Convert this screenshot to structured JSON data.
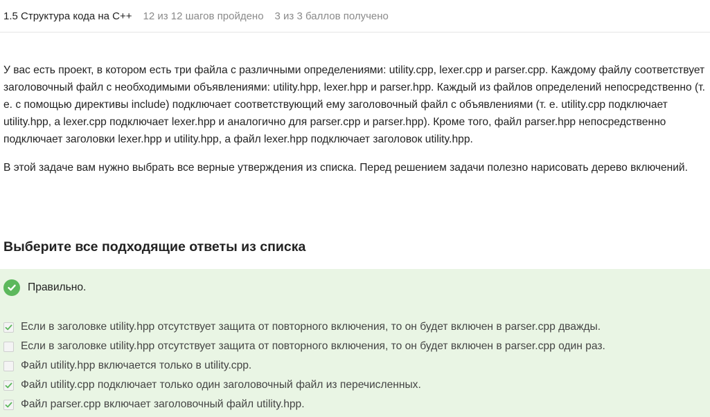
{
  "header": {
    "lesson_title": "1.5 Структура кода на C++",
    "steps_progress": "12 из 12 шагов пройдено",
    "score": "3 из 3 баллов  получено"
  },
  "problem": {
    "paragraphs": [
      "У вас есть проект, в котором есть три файла с различными определениями: utility.cpp, lexer.cpp и parser.cpp. Каждому файлу соответствует заголовочный файл с необходимыми объявлениями: utility.hpp, lexer.hpp и parser.hpp. Каждый из файлов определений непосредственно (т. е. с помощью директивы include) подключает соответствующий ему заголовочный файл с объявлениями (т. е. utility.cpp подключает utility.hpp, а lexer.cpp подключает lexer.hpp и аналогично для parser.cpp и parser.hpp). Кроме того, файл parser.hpp непосредственно подключает заголовки lexer.hpp и utility.hpp, а файл lexer.hpp подключает заголовок utility.hpp.",
      "В этой задаче вам нужно выбрать все верные утверждения из списка. Перед решением задачи полезно нарисовать дерево включений."
    ]
  },
  "question": {
    "heading": "Выберите все подходящие ответы из списка",
    "status_text": "Правильно.",
    "status_color": "#5cb85c",
    "options": [
      {
        "label": "Если в заголовке utility.hpp отсутствует защита от повторного включения, то он будет включен в parser.cpp дважды.",
        "checked": true
      },
      {
        "label": "Если в заголовке utility.hpp отсутствует защита от повторного включения, то он будет включен в parser.cpp один раз.",
        "checked": false
      },
      {
        "label": "Файл utility.hpp включается только в utility.cpp.",
        "checked": false
      },
      {
        "label": "Файл utility.cpp подключает только один заголовочный файл из перечисленных.",
        "checked": true
      },
      {
        "label": "Файл parser.cpp включает заголовочный файл utility.hpp.",
        "checked": true
      }
    ]
  }
}
